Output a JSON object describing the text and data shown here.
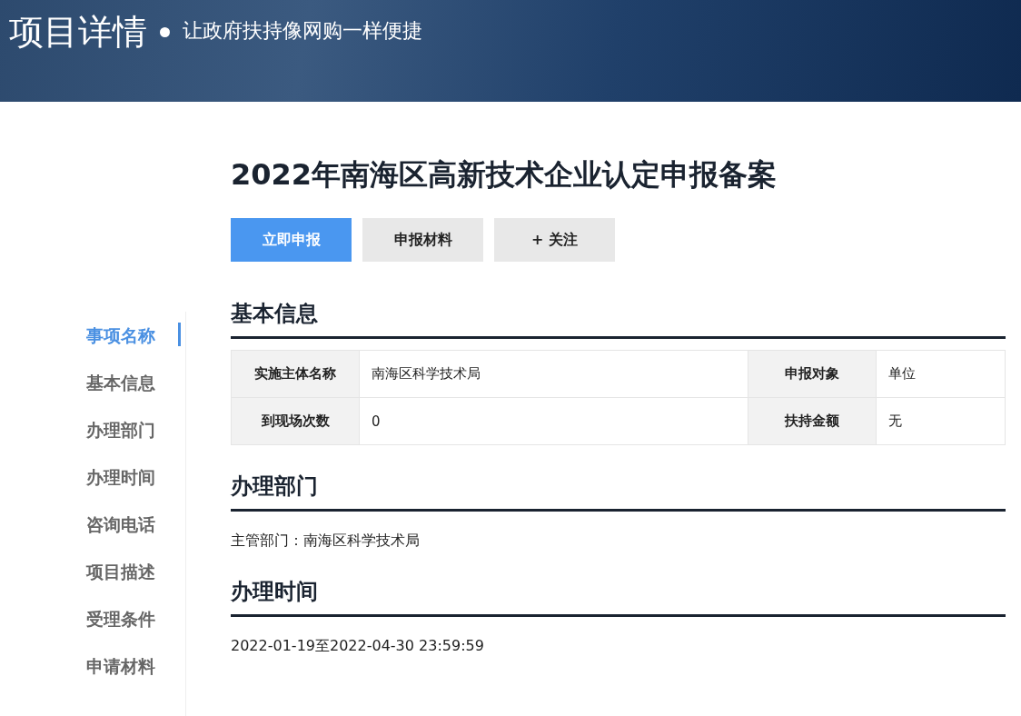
{
  "header": {
    "title": "项目详情",
    "subtitle": "让政府扶持像网购一样便捷"
  },
  "project": {
    "title": "2022年南海区高新技术企业认定申报备案",
    "buttons": [
      {
        "label": "立即申报",
        "kind": "primary"
      },
      {
        "label": "申报材料",
        "kind": "secondary"
      },
      {
        "label": "+ 关注",
        "kind": "secondary"
      }
    ]
  },
  "side_nav": [
    {
      "label": "事项名称",
      "selected": true
    },
    {
      "label": "基本信息",
      "selected": false
    },
    {
      "label": "办理部门",
      "selected": false
    },
    {
      "label": "办理时间",
      "selected": false
    },
    {
      "label": "咨询电话",
      "selected": false
    },
    {
      "label": "项目描述",
      "selected": false
    },
    {
      "label": "受理条件",
      "selected": false
    },
    {
      "label": "申请材料",
      "selected": false
    }
  ],
  "sections": [
    {
      "title": "基本信息",
      "kind": "table",
      "rows": [
        [
          {
            "label": "实施主体名称",
            "value": "南海区科学技术局"
          },
          {
            "label": "申报对象",
            "value": "单位"
          }
        ],
        [
          {
            "label": "到现场次数",
            "value": "0"
          },
          {
            "label": "扶持金额",
            "value": "无"
          }
        ]
      ]
    },
    {
      "title": "办理部门",
      "kind": "text",
      "text": "主管部门：南海区科学技术局"
    },
    {
      "title": "办理时间",
      "kind": "text",
      "text": "2022-01-19至2022-04-30 23:59:59"
    }
  ]
}
